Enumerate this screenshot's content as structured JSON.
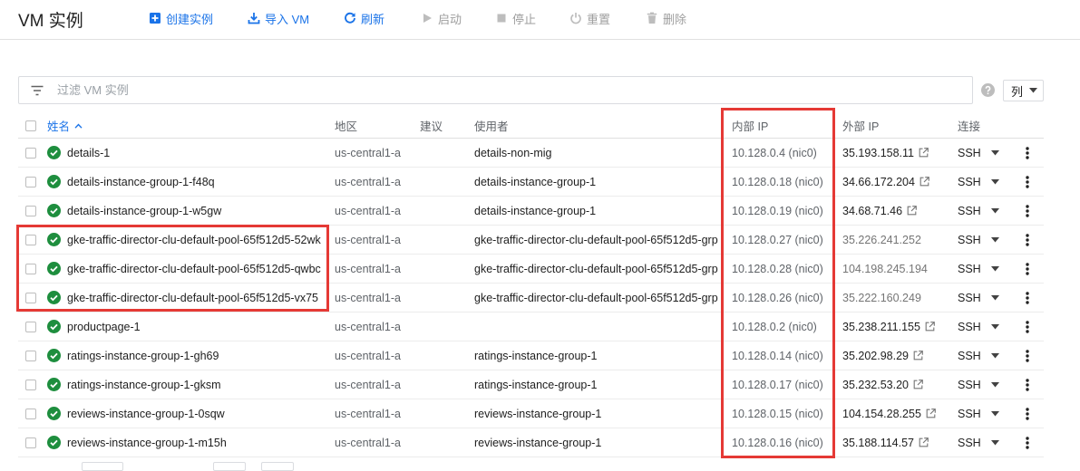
{
  "toolbar": {
    "title": "VM 实例",
    "create_label": "创建实例",
    "import_label": "导入 VM",
    "refresh_label": "刷新",
    "start_label": "启动",
    "stop_label": "停止",
    "reset_label": "重置",
    "delete_label": "删除"
  },
  "filter": {
    "placeholder": "过滤 VM 实例",
    "columns_label": "列"
  },
  "table": {
    "headers": {
      "name": "姓名",
      "zone": "地区",
      "recommendation": "建议",
      "in_use_by": "使用者",
      "internal_ip": "内部 IP",
      "external_ip": "外部 IP",
      "connect": "连接"
    },
    "rows": [
      {
        "name": "details-1",
        "zone": "us-central1-a",
        "in_use_by": "details-non-mig",
        "internal_ip": "10.128.0.4 (nic0)",
        "external_ip": "35.193.158.11",
        "connect": "SSH"
      },
      {
        "name": "details-instance-group-1-f48q",
        "zone": "us-central1-a",
        "in_use_by": "details-instance-group-1",
        "internal_ip": "10.128.0.18 (nic0)",
        "external_ip": "34.66.172.204",
        "connect": "SSH"
      },
      {
        "name": "details-instance-group-1-w5gw",
        "zone": "us-central1-a",
        "in_use_by": "details-instance-group-1",
        "internal_ip": "10.128.0.19 (nic0)",
        "external_ip": "34.68.71.46",
        "connect": "SSH"
      },
      {
        "name": "gke-traffic-director-clu-default-pool-65f512d5-52wk",
        "zone": "us-central1-a",
        "in_use_by": "gke-traffic-director-clu-default-pool-65f512d5-grp",
        "internal_ip": "10.128.0.27 (nic0)",
        "external_ip": "35.226.241.252",
        "connect": "SSH"
      },
      {
        "name": "gke-traffic-director-clu-default-pool-65f512d5-qwbc",
        "zone": "us-central1-a",
        "in_use_by": "gke-traffic-director-clu-default-pool-65f512d5-grp",
        "internal_ip": "10.128.0.28 (nic0)",
        "external_ip": "104.198.245.194",
        "connect": "SSH"
      },
      {
        "name": "gke-traffic-director-clu-default-pool-65f512d5-vx75",
        "zone": "us-central1-a",
        "in_use_by": "gke-traffic-director-clu-default-pool-65f512d5-grp",
        "internal_ip": "10.128.0.26 (nic0)",
        "external_ip": "35.222.160.249",
        "connect": "SSH"
      },
      {
        "name": "productpage-1",
        "zone": "us-central1-a",
        "in_use_by": "",
        "internal_ip": "10.128.0.2 (nic0)",
        "external_ip": "35.238.211.155",
        "connect": "SSH"
      },
      {
        "name": "ratings-instance-group-1-gh69",
        "zone": "us-central1-a",
        "in_use_by": "ratings-instance-group-1",
        "internal_ip": "10.128.0.14 (nic0)",
        "external_ip": "35.202.98.29",
        "connect": "SSH"
      },
      {
        "name": "ratings-instance-group-1-gksm",
        "zone": "us-central1-a",
        "in_use_by": "ratings-instance-group-1",
        "internal_ip": "10.128.0.17 (nic0)",
        "external_ip": "35.232.53.20",
        "connect": "SSH"
      },
      {
        "name": "reviews-instance-group-1-0sqw",
        "zone": "us-central1-a",
        "in_use_by": "reviews-instance-group-1",
        "internal_ip": "10.128.0.15 (nic0)",
        "external_ip": "104.154.28.255",
        "connect": "SSH"
      },
      {
        "name": "reviews-instance-group-1-m15h",
        "zone": "us-central1-a",
        "in_use_by": "reviews-instance-group-1",
        "internal_ip": "10.128.0.16 (nic0)",
        "external_ip": "35.188.114.57",
        "connect": "SSH"
      }
    ]
  },
  "colors": {
    "accent": "#1a73e8",
    "status_ok": "#1e8e3e",
    "highlight": "#e53935"
  }
}
